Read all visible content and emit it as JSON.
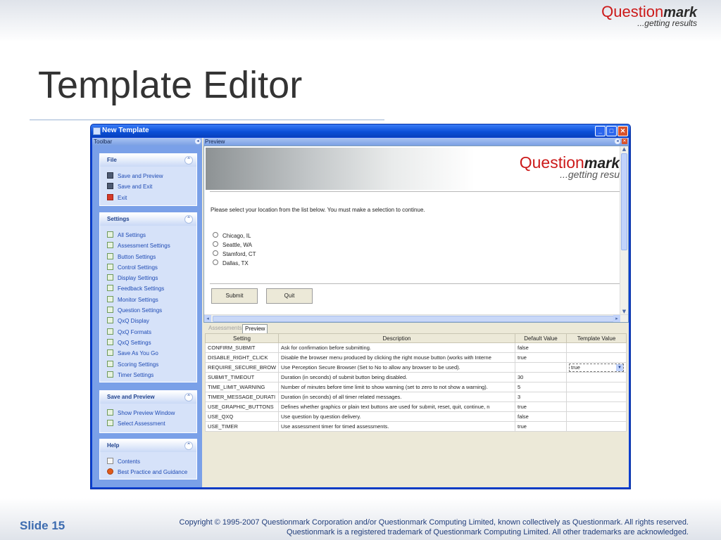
{
  "slide": {
    "brand_question": "Question",
    "brand_mark": "mark",
    "brand_tagline": "...getting results",
    "title": "Template Editor",
    "number": "Slide 15",
    "copyright_line1": "Copyright © 1995-2007 Questionmark Corporation and/or Questionmark Computing Limited, known collectively as Questionmark. All rights reserved.",
    "copyright_line2": "Questionmark is a registered trademark of Questionmark Computing Limited. All other trademarks are acknowledged."
  },
  "window": {
    "title": "New Template",
    "toolbar_label": "Toolbar",
    "preview_label": "Preview"
  },
  "sidebar": {
    "file": {
      "title": "File",
      "items": [
        "Save and Preview",
        "Save and Exit",
        "Exit"
      ]
    },
    "settings": {
      "title": "Settings",
      "items": [
        "All Settings",
        "Assessment Settings",
        "Button Settings",
        "Control Settings",
        "Display Settings",
        "Feedback Settings",
        "Monitor Settings",
        "Question Settings",
        "QxQ Display",
        "QxQ Formats",
        "QxQ Settings",
        "Save As You Go",
        "Scoring Settings",
        "Timer Settings"
      ]
    },
    "save_preview": {
      "title": "Save and Preview",
      "items": [
        "Show Preview Window",
        "Select Assessment"
      ]
    },
    "help": {
      "title": "Help",
      "items": [
        "Contents",
        "Best Practice and Guidance"
      ]
    }
  },
  "preview": {
    "brand_question": "Question",
    "brand_mark": "mark",
    "brand_tagline": "...getting resu",
    "prompt": "Please select your location from the list below.  You must make a selection to continue.",
    "options": [
      "Chicago, IL",
      "Seattle, WA",
      "Stamford, CT",
      "Dallas, TX"
    ],
    "submit_label": "Submit",
    "quit_label": "Quit"
  },
  "tabs": {
    "assessments": "Assessments",
    "preview": "Preview"
  },
  "grid": {
    "headers": [
      "Setting",
      "Description",
      "Default Value",
      "Template Value"
    ],
    "rows": [
      [
        "CONFIRM_SUBMIT",
        "Ask for confirmation before submitting.",
        "false",
        ""
      ],
      [
        "DISABLE_RIGHT_CLICK",
        "Disable the browser menu produced by clicking the right mouse button (works with Interne",
        "true",
        ""
      ],
      [
        "REQUIRE_SECURE_BROW",
        "Use Perception Secure Browser (Set to No to allow any browser to be used).",
        "",
        "true"
      ],
      [
        "SUBMIT_TIMEOUT",
        "Duration (in seconds) of submit button being disabled.",
        "30",
        ""
      ],
      [
        "TIME_LIMIT_WARNING",
        "Number of minutes before time limit to show warning (set to zero to not show a warning).",
        "5",
        ""
      ],
      [
        "TIMER_MESSAGE_DURATI",
        "Duration (in seconds) of all timer related messages.",
        "3",
        ""
      ],
      [
        "USE_GRAPHIC_BUTTONS",
        "Defines whether graphics or plain text buttons are used for submit, reset, quit, continue, n",
        "true",
        ""
      ],
      [
        "USE_QXQ",
        "Use question by question delivery.",
        "false",
        ""
      ],
      [
        "USE_TIMER",
        "Use assessment timer for timed assessments.",
        "true",
        ""
      ]
    ]
  }
}
